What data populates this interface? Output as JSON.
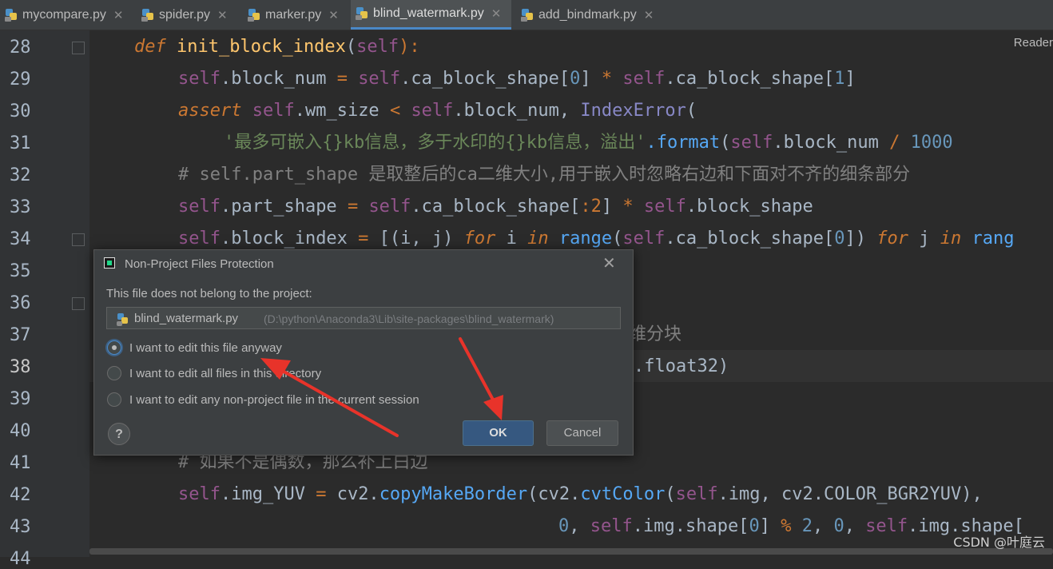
{
  "tabs": [
    {
      "label": "mycompare.py",
      "active": false
    },
    {
      "label": "spider.py",
      "active": false
    },
    {
      "label": "marker.py",
      "active": false
    },
    {
      "label": "blind_watermark.py",
      "active": true
    },
    {
      "label": "add_bindmark.py",
      "active": false
    }
  ],
  "editor": {
    "reader_mode": "Reader",
    "line_numbers": [
      "28",
      "29",
      "30",
      "31",
      "32",
      "33",
      "34",
      "35",
      "36",
      "37",
      "38",
      "39",
      "40",
      "41",
      "42",
      "43",
      "44"
    ],
    "current_line": "38",
    "lines": {
      "l28": {
        "def": "def",
        "name": "init_block_index",
        "p1": "(",
        "self": "self",
        "p2": "):"
      },
      "l29": {
        "self1": "self",
        "t1": ".block_num ",
        "eq": "=",
        "sp1": " ",
        "self2": "self",
        "t2": ".ca_block_shape[",
        "n0": "0",
        "t3": "] ",
        "mul": "*",
        "sp2": " ",
        "self3": "self",
        "t4": ".ca_block_shape[",
        "n1": "1",
        "t5": "]"
      },
      "l30": {
        "kw": "assert",
        "sp": " ",
        "self1": "self",
        "t1": ".wm_size ",
        "lt": "<",
        "sp2": " ",
        "self2": "self",
        "t2": ".block_num, ",
        "cls": "IndexError",
        "t3": "("
      },
      "l31": {
        "str": "'最多可嵌入{}kb信息，多于水印的{}kb信息，溢出'",
        "fmt": ".format",
        "t1": "(",
        "self": "self",
        "t2": ".block_num ",
        "div": "/",
        "sp": " ",
        "num": "1000"
      },
      "l32": {
        "cmt": "# self.part_shape 是取整后的ca二维大小,用于嵌入时忽略右边和下面对不齐的细条部分"
      },
      "l33": {
        "self1": "self",
        "t1": ".part_shape ",
        "eq": "=",
        "sp": " ",
        "self2": "self",
        "t2": ".ca_block_shape[",
        "sl": ":2",
        "t3": "] ",
        "mul": "*",
        "sp2": " ",
        "self3": "self",
        "t4": ".block_shape"
      },
      "l34": {
        "self1": "self",
        "t1": ".block_index ",
        "eq": "=",
        "t2": " [(i, j) ",
        "for1": "for",
        "t3": " i ",
        "in1": "in",
        "sp": " ",
        "rng": "range",
        "t4": "(",
        "self2": "self",
        "t5": ".ca_block_shape[",
        "n0": "0",
        "t6": "]) ",
        "for2": "for",
        "t7": " j ",
        "in2": "in",
        "sp2": " ",
        "rng2": "rang"
      },
      "l37": {
        "cmt": "维分块"
      },
      "l38": {
        "t1": ".float32)"
      },
      "l41": {
        "cmt": "# 如果不是偶数，那么补上白边"
      },
      "l42": {
        "self1": "self",
        "t1": ".img_YUV ",
        "eq": "=",
        "t2": " cv2.",
        "f1": "copyMakeBorder",
        "t3": "(cv2.",
        "f2": "cvtColor",
        "t4": "(",
        "self2": "self",
        "t5": ".img, cv2.COLOR_BGR2YUV),"
      },
      "l43": {
        "n0": "0",
        "t1": ", ",
        "self1": "self",
        "t2": ".img.shape[",
        "n1": "0",
        "t3": "] ",
        "mod": "%",
        "sp": " ",
        "n2": "2",
        "t4": ", ",
        "n3": "0",
        "t5": ", ",
        "self2": "self",
        "t6": ".img.shape["
      }
    }
  },
  "dialog": {
    "title": "Non-Project Files Protection",
    "message": "This file does not belong to the project:",
    "file_name": "blind_watermark.py",
    "file_path": "(D:\\python\\Anaconda3\\Lib\\site-packages\\blind_watermark)",
    "options": [
      {
        "label": "I want to edit this file anyway",
        "selected": true
      },
      {
        "label": "I want to edit all files in this directory",
        "selected": false
      },
      {
        "label": "I want to edit any non-project file in the current session",
        "selected": false
      }
    ],
    "help_label": "?",
    "ok_label": "OK",
    "cancel_label": "Cancel",
    "close_label": "✕"
  },
  "watermark": "CSDN @叶庭云",
  "colors": {
    "background": "#2b2b2b",
    "dialog": "#3c3f41",
    "ok_button": "#365880",
    "arrow": "#e8332a"
  },
  "icons": {
    "python_file": "python-file-icon",
    "app": "pycharm-icon",
    "close": "close-icon",
    "help": "help-icon"
  }
}
